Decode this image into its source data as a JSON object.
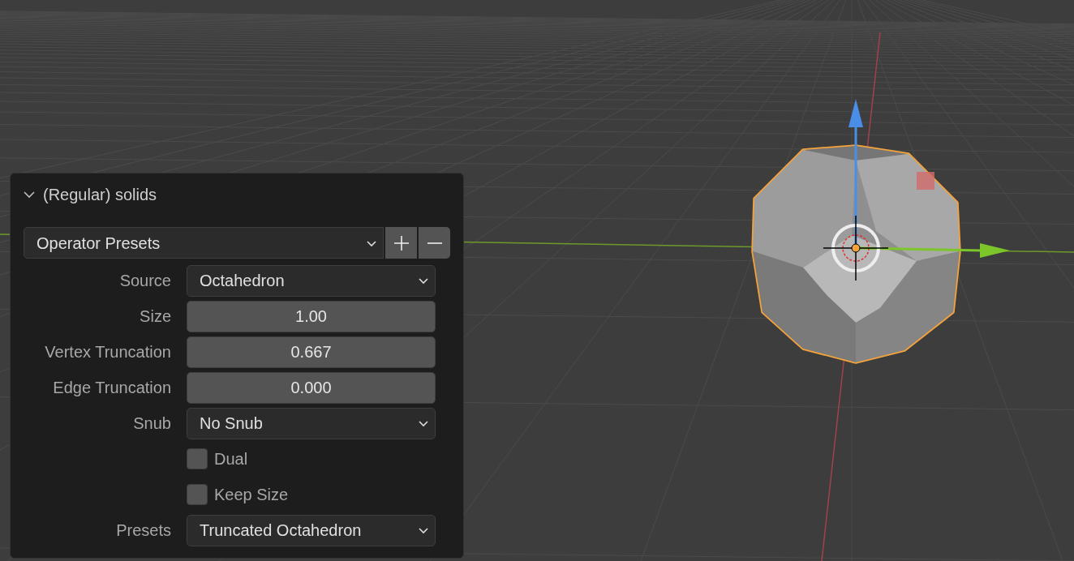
{
  "panel": {
    "title": "(Regular) solids",
    "expanded": true
  },
  "presets": {
    "label": "Operator Presets"
  },
  "fields": [
    {
      "kind": "dropdown",
      "label": "Source",
      "value": "Octahedron"
    },
    {
      "kind": "number",
      "label": "Size",
      "value": "1.00"
    },
    {
      "kind": "number",
      "label": "Vertex Truncation",
      "value": "0.667"
    },
    {
      "kind": "number",
      "label": "Edge Truncation",
      "value": "0.000"
    },
    {
      "kind": "dropdown",
      "label": "Snub",
      "value": "No Snub"
    },
    {
      "kind": "checkbox",
      "label": "Dual",
      "checked": false
    },
    {
      "kind": "checkbox",
      "label": "Keep Size",
      "checked": false
    },
    {
      "kind": "dropdown",
      "label": "Presets",
      "value": "Truncated Octahedron"
    }
  ]
}
